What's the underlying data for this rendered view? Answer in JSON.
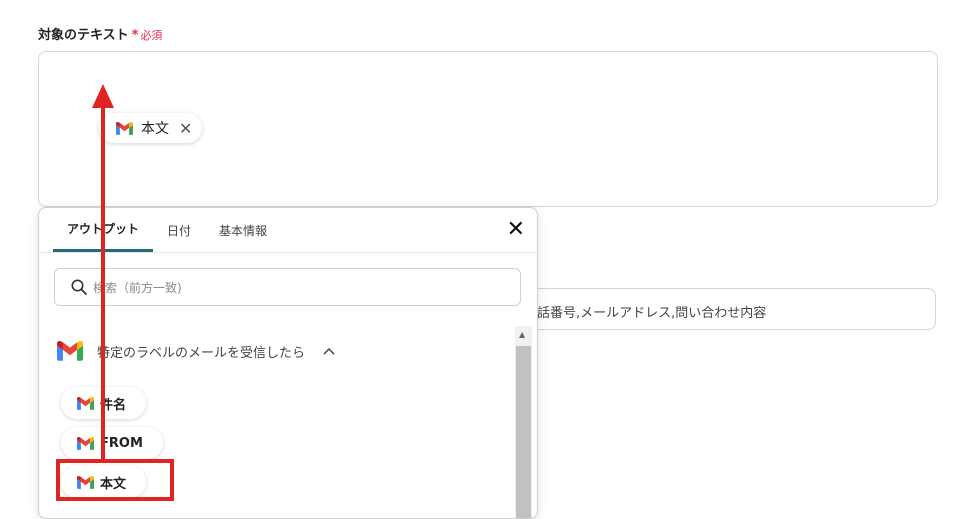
{
  "field": {
    "label": "対象のテキスト",
    "required_star": "*",
    "required_text": "必須",
    "chip_label": "本文",
    "chip_close": "✕"
  },
  "second_field": {
    "visible_text": "話番号,メールアドレス,問い合わせ内容"
  },
  "popup": {
    "tabs": [
      {
        "label": "アウトプット",
        "active": true
      },
      {
        "label": "日付",
        "active": false
      },
      {
        "label": "基本情報",
        "active": false
      }
    ],
    "close": "✕",
    "search_placeholder": "検索（前方一致)",
    "group_title": "特定のラベルのメールを受信したら",
    "group_chevron": "^",
    "items": [
      {
        "label": "件名"
      },
      {
        "label": "FROM"
      },
      {
        "label": "本文"
      }
    ]
  },
  "colors": {
    "accent_tab": "#1e6f78",
    "required": "#e8334a",
    "annotation": "#e02424"
  },
  "icons": [
    "gmail-icon",
    "close-icon",
    "search-icon",
    "chevron-up-icon"
  ]
}
